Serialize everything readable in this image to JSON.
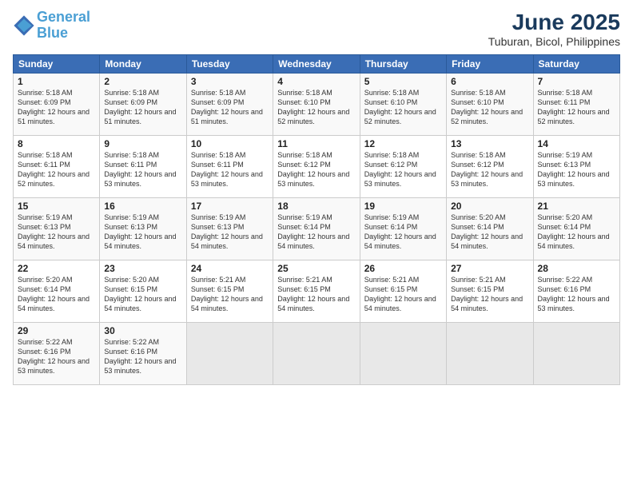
{
  "logo": {
    "line1": "General",
    "line2": "Blue"
  },
  "title": "June 2025",
  "subtitle": "Tuburan, Bicol, Philippines",
  "days_header": [
    "Sunday",
    "Monday",
    "Tuesday",
    "Wednesday",
    "Thursday",
    "Friday",
    "Saturday"
  ],
  "weeks": [
    [
      {
        "day": "1",
        "sunrise": "5:18 AM",
        "sunset": "6:09 PM",
        "daylight": "12 hours and 51 minutes."
      },
      {
        "day": "2",
        "sunrise": "5:18 AM",
        "sunset": "6:09 PM",
        "daylight": "12 hours and 51 minutes."
      },
      {
        "day": "3",
        "sunrise": "5:18 AM",
        "sunset": "6:09 PM",
        "daylight": "12 hours and 51 minutes."
      },
      {
        "day": "4",
        "sunrise": "5:18 AM",
        "sunset": "6:10 PM",
        "daylight": "12 hours and 52 minutes."
      },
      {
        "day": "5",
        "sunrise": "5:18 AM",
        "sunset": "6:10 PM",
        "daylight": "12 hours and 52 minutes."
      },
      {
        "day": "6",
        "sunrise": "5:18 AM",
        "sunset": "6:10 PM",
        "daylight": "12 hours and 52 minutes."
      },
      {
        "day": "7",
        "sunrise": "5:18 AM",
        "sunset": "6:11 PM",
        "daylight": "12 hours and 52 minutes."
      }
    ],
    [
      {
        "day": "8",
        "sunrise": "5:18 AM",
        "sunset": "6:11 PM",
        "daylight": "12 hours and 52 minutes."
      },
      {
        "day": "9",
        "sunrise": "5:18 AM",
        "sunset": "6:11 PM",
        "daylight": "12 hours and 53 minutes."
      },
      {
        "day": "10",
        "sunrise": "5:18 AM",
        "sunset": "6:11 PM",
        "daylight": "12 hours and 53 minutes."
      },
      {
        "day": "11",
        "sunrise": "5:18 AM",
        "sunset": "6:12 PM",
        "daylight": "12 hours and 53 minutes."
      },
      {
        "day": "12",
        "sunrise": "5:18 AM",
        "sunset": "6:12 PM",
        "daylight": "12 hours and 53 minutes."
      },
      {
        "day": "13",
        "sunrise": "5:18 AM",
        "sunset": "6:12 PM",
        "daylight": "12 hours and 53 minutes."
      },
      {
        "day": "14",
        "sunrise": "5:19 AM",
        "sunset": "6:13 PM",
        "daylight": "12 hours and 53 minutes."
      }
    ],
    [
      {
        "day": "15",
        "sunrise": "5:19 AM",
        "sunset": "6:13 PM",
        "daylight": "12 hours and 54 minutes."
      },
      {
        "day": "16",
        "sunrise": "5:19 AM",
        "sunset": "6:13 PM",
        "daylight": "12 hours and 54 minutes."
      },
      {
        "day": "17",
        "sunrise": "5:19 AM",
        "sunset": "6:13 PM",
        "daylight": "12 hours and 54 minutes."
      },
      {
        "day": "18",
        "sunrise": "5:19 AM",
        "sunset": "6:14 PM",
        "daylight": "12 hours and 54 minutes."
      },
      {
        "day": "19",
        "sunrise": "5:19 AM",
        "sunset": "6:14 PM",
        "daylight": "12 hours and 54 minutes."
      },
      {
        "day": "20",
        "sunrise": "5:20 AM",
        "sunset": "6:14 PM",
        "daylight": "12 hours and 54 minutes."
      },
      {
        "day": "21",
        "sunrise": "5:20 AM",
        "sunset": "6:14 PM",
        "daylight": "12 hours and 54 minutes."
      }
    ],
    [
      {
        "day": "22",
        "sunrise": "5:20 AM",
        "sunset": "6:14 PM",
        "daylight": "12 hours and 54 minutes."
      },
      {
        "day": "23",
        "sunrise": "5:20 AM",
        "sunset": "6:15 PM",
        "daylight": "12 hours and 54 minutes."
      },
      {
        "day": "24",
        "sunrise": "5:21 AM",
        "sunset": "6:15 PM",
        "daylight": "12 hours and 54 minutes."
      },
      {
        "day": "25",
        "sunrise": "5:21 AM",
        "sunset": "6:15 PM",
        "daylight": "12 hours and 54 minutes."
      },
      {
        "day": "26",
        "sunrise": "5:21 AM",
        "sunset": "6:15 PM",
        "daylight": "12 hours and 54 minutes."
      },
      {
        "day": "27",
        "sunrise": "5:21 AM",
        "sunset": "6:15 PM",
        "daylight": "12 hours and 54 minutes."
      },
      {
        "day": "28",
        "sunrise": "5:22 AM",
        "sunset": "6:16 PM",
        "daylight": "12 hours and 53 minutes."
      }
    ],
    [
      {
        "day": "29",
        "sunrise": "5:22 AM",
        "sunset": "6:16 PM",
        "daylight": "12 hours and 53 minutes."
      },
      {
        "day": "30",
        "sunrise": "5:22 AM",
        "sunset": "6:16 PM",
        "daylight": "12 hours and 53 minutes."
      },
      {
        "day": "",
        "sunrise": "",
        "sunset": "",
        "daylight": ""
      },
      {
        "day": "",
        "sunrise": "",
        "sunset": "",
        "daylight": ""
      },
      {
        "day": "",
        "sunrise": "",
        "sunset": "",
        "daylight": ""
      },
      {
        "day": "",
        "sunrise": "",
        "sunset": "",
        "daylight": ""
      },
      {
        "day": "",
        "sunrise": "",
        "sunset": "",
        "daylight": ""
      }
    ]
  ]
}
